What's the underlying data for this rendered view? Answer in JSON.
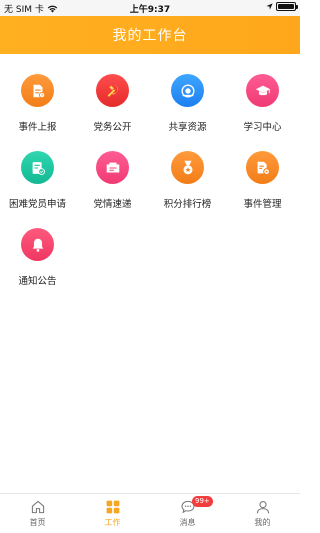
{
  "status_bar": {
    "carrier": "无 SIM 卡",
    "time": "上午9:37",
    "battery_level": 1.0
  },
  "header": {
    "title": "我的工作台"
  },
  "tiles": [
    {
      "label": "事件上报",
      "icon": "report-document-icon",
      "color": "#f5831f"
    },
    {
      "label": "党务公开",
      "icon": "party-emblem-icon",
      "color": "#ea3030"
    },
    {
      "label": "共享资源",
      "icon": "share-resource-icon",
      "color": "#2b8ff5"
    },
    {
      "label": "学习中心",
      "icon": "graduation-cap-icon",
      "color": "#f24479"
    },
    {
      "label": "困难党员申请",
      "icon": "application-form-icon",
      "color": "#1ec49f"
    },
    {
      "label": "党情速递",
      "icon": "express-message-icon",
      "color": "#f24479"
    },
    {
      "label": "积分排行榜",
      "icon": "medal-icon",
      "color": "#f5831f"
    },
    {
      "label": "事件管理",
      "icon": "document-settings-icon",
      "color": "#f5831f"
    },
    {
      "label": "通知公告",
      "icon": "bell-icon",
      "color": "#ef3b5e"
    }
  ],
  "tabbar": {
    "items": [
      {
        "label": "首页",
        "icon": "home-icon",
        "active": false
      },
      {
        "label": "工作",
        "icon": "grid-apps-icon",
        "active": true
      },
      {
        "label": "消息",
        "icon": "chat-bubble-icon",
        "active": false,
        "badge": "99+"
      },
      {
        "label": "我的",
        "icon": "user-icon",
        "active": false
      }
    ],
    "active_color": "#f5a623"
  }
}
